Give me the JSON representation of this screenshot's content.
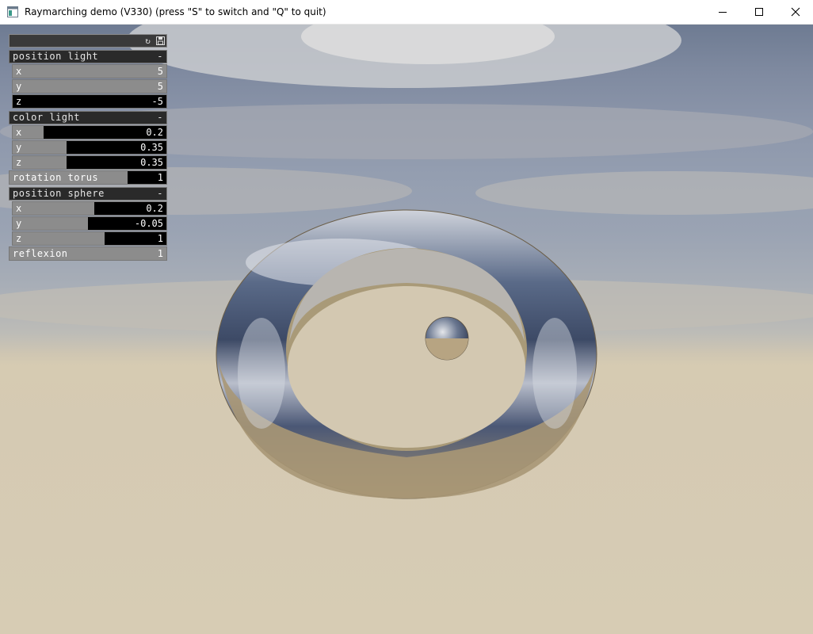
{
  "window": {
    "title": "Raymarching demo (V330) (press \"S\" to switch and \"Q\" to quit)",
    "icon": "app-window-icon",
    "controls": [
      "minimize-icon",
      "maximize-icon",
      "close-icon"
    ]
  },
  "gui": {
    "header_icons": [
      "refresh-icon",
      "save-icon"
    ],
    "groups": [
      {
        "title": "position light",
        "collapse": "-",
        "params": [
          {
            "label": "x",
            "value": "5",
            "fill": 1.0
          },
          {
            "label": "y",
            "value": "5",
            "fill": 1.0
          },
          {
            "label": "z",
            "value": "-5",
            "fill": 0.0
          }
        ]
      },
      {
        "title": "color light",
        "collapse": "-",
        "params": [
          {
            "label": "x",
            "value": "0.2",
            "fill": 0.2
          },
          {
            "label": "y",
            "value": "0.35",
            "fill": 0.35
          },
          {
            "label": "z",
            "value": "0.35",
            "fill": 0.35
          }
        ]
      },
      {
        "standalone": {
          "label": "rotation torus",
          "value": "1",
          "fill": 0.75
        }
      },
      {
        "title": "position sphere",
        "collapse": "-",
        "params": [
          {
            "label": "x",
            "value": "0.2",
            "fill": 0.53
          },
          {
            "label": "y",
            "value": "-0.05",
            "fill": 0.49
          },
          {
            "label": "z",
            "value": "1",
            "fill": 0.6
          }
        ]
      },
      {
        "standalone": {
          "label": "reflexion",
          "value": "1",
          "fill": 1.0
        }
      }
    ]
  },
  "colors": {
    "slider_fill": "#8c8c8c",
    "slider_bg": "#000000",
    "torus_inner": "#a99a78",
    "ground": "#d6cbb2"
  }
}
